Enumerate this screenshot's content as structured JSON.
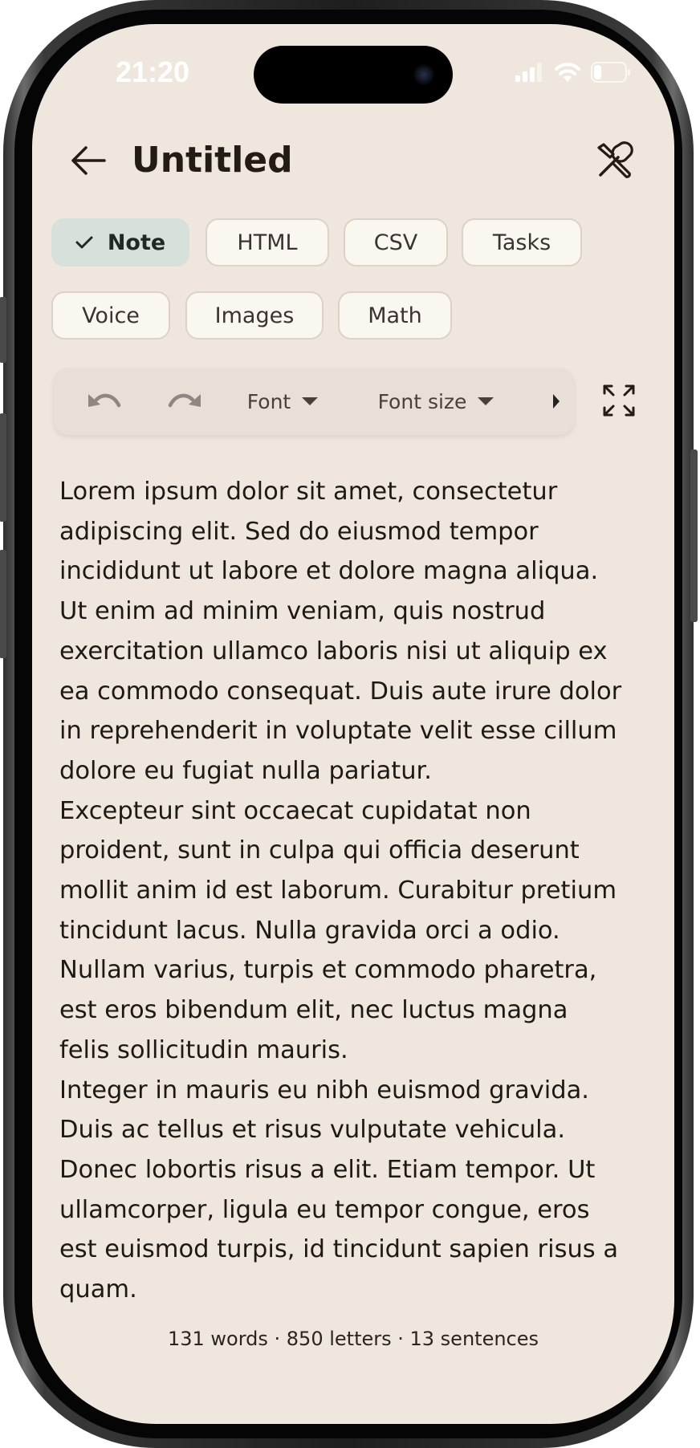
{
  "status_bar": {
    "time": "21:20"
  },
  "header": {
    "title": "Untitled"
  },
  "modes": [
    {
      "label": "Note",
      "selected": true
    },
    {
      "label": "HTML",
      "selected": false
    },
    {
      "label": "CSV",
      "selected": false
    },
    {
      "label": "Tasks",
      "selected": false
    },
    {
      "label": "Voice",
      "selected": false
    },
    {
      "label": "Images",
      "selected": false
    },
    {
      "label": "Math",
      "selected": false
    }
  ],
  "toolbar": {
    "font_label": "Font",
    "font_size_label": "Font size"
  },
  "editor": {
    "lines": [
      "Lorem ipsum dolor sit amet, consectetur",
      "adipiscing elit. Sed do eiusmod tempor",
      "incididunt ut labore et dolore magna aliqua.",
      "Ut enim ad minim veniam, quis nostrud",
      "exercitation ullamco laboris nisi ut aliquip ex",
      "ea commodo consequat. Duis aute irure dolor",
      "in reprehenderit in voluptate velit esse cillum",
      "dolore eu fugiat nulla pariatur.",
      "Excepteur sint occaecat cupidatat non",
      "proident, sunt in culpa qui officia deserunt",
      "mollit anim id est laborum. Curabitur pretium",
      "tincidunt lacus. Nulla gravida orci a odio.",
      "Nullam varius, turpis et commodo pharetra,",
      "est eros bibendum elit, nec luctus magna",
      "felis sollicitudin mauris.",
      "Integer in mauris eu nibh euismod gravida.",
      "Duis ac tellus et risus vulputate vehicula.",
      "Donec lobortis risus a elit. Etiam tempor. Ut",
      "ullamcorper, ligula eu tempor congue, eros",
      "est euismod turpis, id tincidunt sapien risus a",
      "quam."
    ]
  },
  "stats": {
    "text": "131 words · 850 letters · 13 sentences"
  },
  "colors": {
    "background": "#efe7dd",
    "selected_chip": "#d7e0da",
    "chip": "#faf6f0",
    "toolbar": "#e8e0d7",
    "text": "#1d1915"
  },
  "icons": {
    "back": "arrow-left-icon",
    "tools": "tools-icon",
    "undo": "undo-icon",
    "redo": "redo-icon",
    "expand": "expand-icon",
    "check": "check-icon"
  }
}
